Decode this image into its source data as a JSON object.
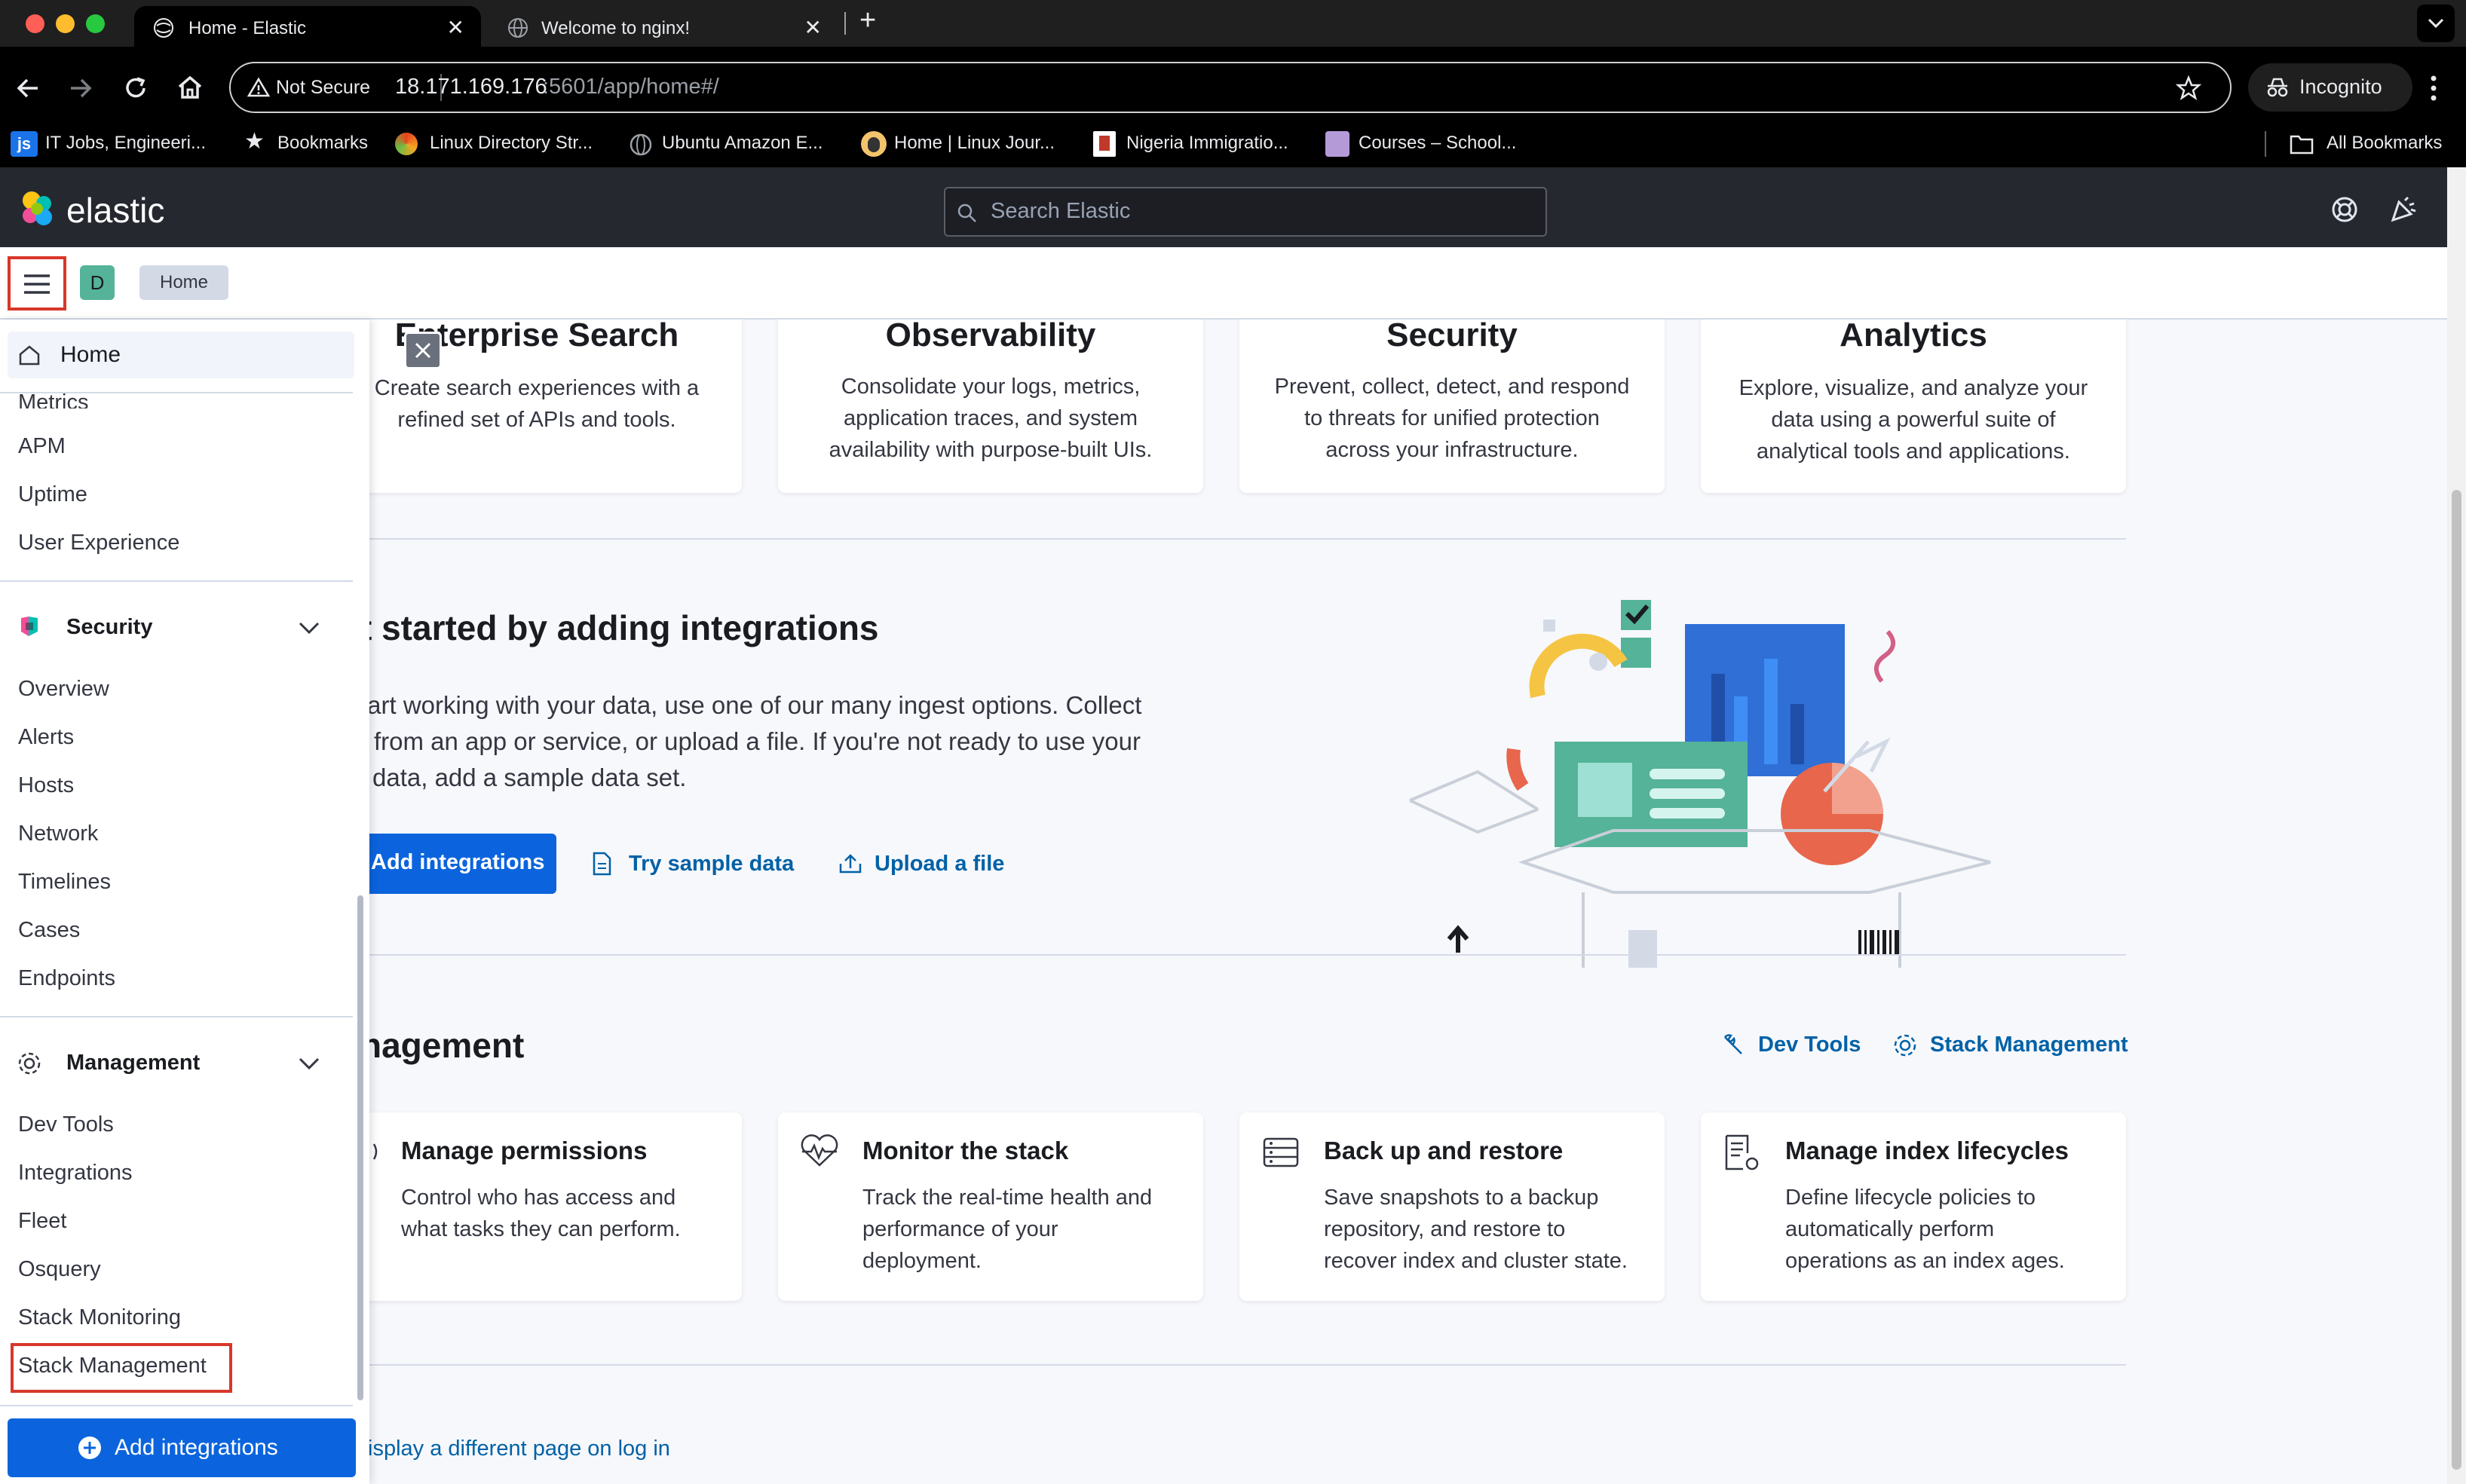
{
  "browser": {
    "tabs": [
      {
        "title": "Home - Elastic",
        "active": true
      },
      {
        "title": "Welcome to nginx!",
        "active": false
      }
    ],
    "new_tab": "+",
    "security_chip": "Not Secure",
    "url_host": "18.171.169.176",
    "url_rest": ":5601/app/home#/",
    "profile": "Incognito",
    "bookmarks": [
      "IT Jobs, Engineeri...",
      "Bookmarks",
      "Linux Directory Str...",
      "Ubuntu Amazon E...",
      "Home | Linux Jour...",
      "Nigeria Immigratio...",
      "Courses – School..."
    ],
    "all_bookmarks": "All Bookmarks"
  },
  "header": {
    "logo_text": "elastic",
    "search_placeholder": "Search Elastic",
    "space_initial": "D",
    "breadcrumb": "Home"
  },
  "sidenav": {
    "home": "Home",
    "observability_items": [
      "Metrics",
      "APM",
      "Uptime",
      "User Experience"
    ],
    "security": {
      "title": "Security",
      "items": [
        "Overview",
        "Alerts",
        "Hosts",
        "Network",
        "Timelines",
        "Cases",
        "Endpoints"
      ]
    },
    "management": {
      "title": "Management",
      "items": [
        "Dev Tools",
        "Integrations",
        "Fleet",
        "Osquery",
        "Stack Monitoring",
        "Stack Management"
      ]
    },
    "add_integrations": "Add integrations"
  },
  "solutions": [
    {
      "title": "Enterprise Search",
      "desc": "Create search experiences with a\nrefined set of APIs and tools."
    },
    {
      "title": "Observability",
      "desc": "Consolidate your logs, metrics,\napplication traces, and system\navailability with purpose-built UIs."
    },
    {
      "title": "Security",
      "desc": "Prevent, collect, detect, and respond\nto threats for unified protection\nacross your infrastructure."
    },
    {
      "title": "Analytics",
      "desc": "Explore, visualize, and analyze your\ndata using a powerful suite of\nanalytical tools and applications."
    }
  ],
  "integrations": {
    "title": "t started by adding integrations",
    "lines": [
      "tart working with your data, use one of our many ingest options. Collect",
      "from an app or service, or upload a file. If you're not ready to use your",
      "data, add a sample data set."
    ],
    "add_button": "Add integrations",
    "sample_link": "Try sample data",
    "upload_link": "Upload a file"
  },
  "management_section": {
    "title": "nagement",
    "dev_tools_link": "Dev Tools",
    "stack_mgmt_link": "Stack Management",
    "cards": [
      {
        "title": "Manage permissions",
        "desc": "Control who has access and\nwhat tasks they can perform."
      },
      {
        "title": "Monitor the stack",
        "desc": "Track the real-time health and\nperformance of your\ndeployment."
      },
      {
        "title": "Back up and restore",
        "desc": "Save snapshots to a backup\nrepository, and restore to\nrecover index and cluster state."
      },
      {
        "title": "Manage index lifecycles",
        "desc": "Define lifecycle policies to\nautomatically perform\noperations as an index ages."
      }
    ]
  },
  "footer_link": "isplay a different page on log in",
  "colors": {
    "accent": "#0b64dd",
    "highlight_box": "#d8372a",
    "header_bg": "#25282f",
    "link": "#0061a6"
  }
}
